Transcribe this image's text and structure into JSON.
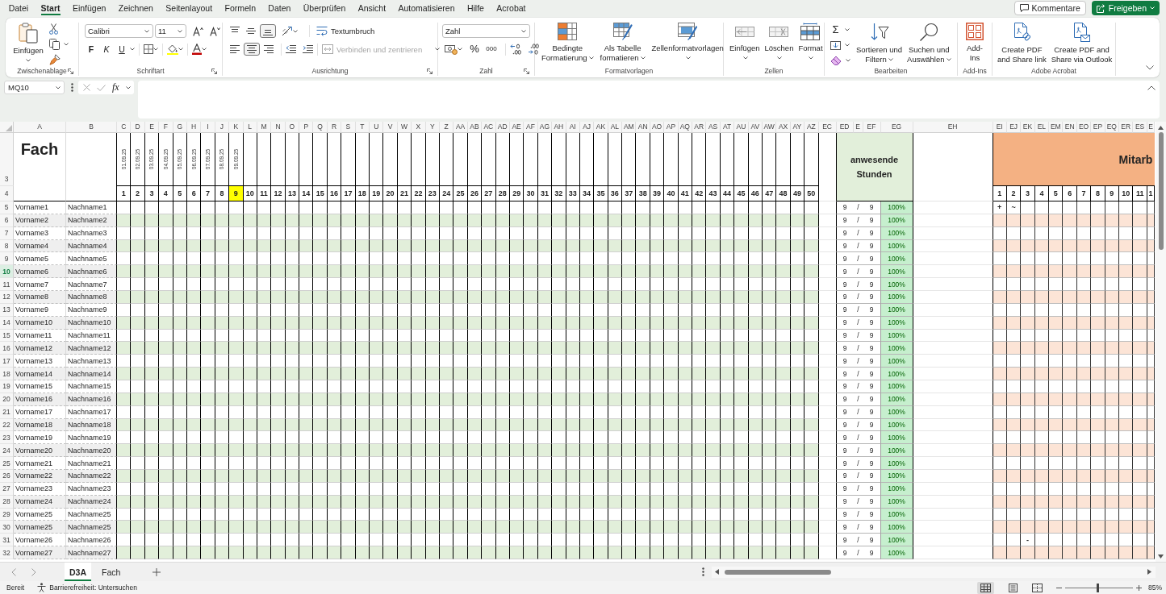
{
  "menu_tabs": [
    {
      "label": "Datei",
      "selected": false
    },
    {
      "label": "Start",
      "selected": true
    },
    {
      "label": "Einfügen",
      "selected": false
    },
    {
      "label": "Zeichnen",
      "selected": false
    },
    {
      "label": "Seitenlayout",
      "selected": false
    },
    {
      "label": "Formeln",
      "selected": false
    },
    {
      "label": "Daten",
      "selected": false
    },
    {
      "label": "Überprüfen",
      "selected": false
    },
    {
      "label": "Ansicht",
      "selected": false
    },
    {
      "label": "Automatisieren",
      "selected": false
    },
    {
      "label": "Hilfe",
      "selected": false
    },
    {
      "label": "Acrobat",
      "selected": false
    }
  ],
  "header_buttons": [
    {
      "label": "Kommentare",
      "kind": "outline"
    },
    {
      "label": "Freigeben",
      "kind": "primary"
    }
  ],
  "ribbon": {
    "clipboard": {
      "label": "Zwischenablage",
      "paste": {
        "lines": [
          "Einfügen"
        ],
        "menu": true
      }
    },
    "font": {
      "label": "Schriftart",
      "font_name": "Calibri",
      "font_size": "11",
      "bold": "F",
      "italic": "K",
      "underline": "U"
    },
    "alignment": {
      "label": "Ausrichtung",
      "vertical_align": [
        {
          "selected": false
        },
        {
          "selected": false
        },
        {
          "selected": true
        }
      ],
      "horizontal_align": [
        {
          "selected": false
        },
        {
          "selected": true
        },
        {
          "selected": false
        }
      ],
      "wrap_text": "Textumbruch",
      "merge": {
        "label": "Verbinden und zentrieren",
        "disabled": true
      }
    },
    "number": {
      "label": "Zahl",
      "format": "Zahl",
      "percent": "%",
      "thousands": "000"
    },
    "styles": {
      "label": "Formatvorlagen",
      "buttons": [
        {
          "lines": [
            "Bedingte",
            "Formatierung"
          ],
          "menu": true
        },
        {
          "lines": [
            "Als Tabelle",
            "formatieren"
          ],
          "menu": true
        },
        {
          "lines": [
            "Zellenformatvorlagen"
          ],
          "menu": true
        }
      ]
    },
    "cells": {
      "label": "Zellen",
      "buttons": [
        {
          "lines": [
            "Einfügen"
          ],
          "menu": true
        },
        {
          "lines": [
            "Löschen"
          ],
          "menu": true
        },
        {
          "lines": [
            "Format"
          ],
          "menu": true
        }
      ]
    },
    "editing": {
      "label": "Bearbeiten",
      "autosum": "Σ",
      "buttons": [
        {
          "lines": [
            "Sortieren und",
            "Filtern"
          ],
          "menu": true
        },
        {
          "lines": [
            "Suchen und",
            "Auswählen"
          ],
          "menu": true
        }
      ]
    },
    "addins": {
      "label": "Add-Ins",
      "button": {
        "lines": [
          "Add-",
          "Ins"
        ]
      }
    },
    "acrobat": {
      "label": "Adobe Acrobat",
      "buttons": [
        {
          "lines": [
            "Create PDF",
            "and Share link"
          ]
        },
        {
          "lines": [
            "Create PDF and",
            "Share via Outlook"
          ]
        }
      ]
    }
  },
  "formula_bar": {
    "name_box": "MQ10",
    "function_label": "fx"
  },
  "sheet": {
    "columns": [
      {
        "letter": "A",
        "kind": "first_name"
      },
      {
        "letter": "B",
        "kind": "last_name"
      },
      {
        "letter": "C",
        "kind": "day"
      },
      {
        "letter": "D",
        "kind": "day"
      },
      {
        "letter": "E",
        "kind": "day"
      },
      {
        "letter": "F",
        "kind": "day"
      },
      {
        "letter": "G",
        "kind": "day"
      },
      {
        "letter": "H",
        "kind": "day"
      },
      {
        "letter": "I",
        "kind": "day"
      },
      {
        "letter": "J",
        "kind": "day"
      },
      {
        "letter": "K",
        "kind": "day"
      },
      {
        "letter": "L",
        "kind": "day"
      },
      {
        "letter": "M",
        "kind": "day"
      },
      {
        "letter": "N",
        "kind": "day"
      },
      {
        "letter": "O",
        "kind": "day"
      },
      {
        "letter": "P",
        "kind": "day"
      },
      {
        "letter": "Q",
        "kind": "day"
      },
      {
        "letter": "R",
        "kind": "day"
      },
      {
        "letter": "S",
        "kind": "day"
      },
      {
        "letter": "T",
        "kind": "day"
      },
      {
        "letter": "U",
        "kind": "day"
      },
      {
        "letter": "V",
        "kind": "day"
      },
      {
        "letter": "W",
        "kind": "day"
      },
      {
        "letter": "X",
        "kind": "day"
      },
      {
        "letter": "Y",
        "kind": "day"
      },
      {
        "letter": "Z",
        "kind": "day"
      },
      {
        "letter": "AA",
        "kind": "day"
      },
      {
        "letter": "AB",
        "kind": "day"
      },
      {
        "letter": "AC",
        "kind": "day"
      },
      {
        "letter": "AD",
        "kind": "day"
      },
      {
        "letter": "AE",
        "kind": "day"
      },
      {
        "letter": "AF",
        "kind": "day"
      },
      {
        "letter": "AG",
        "kind": "day"
      },
      {
        "letter": "AH",
        "kind": "day"
      },
      {
        "letter": "AI",
        "kind": "day"
      },
      {
        "letter": "AJ",
        "kind": "day"
      },
      {
        "letter": "AK",
        "kind": "day"
      },
      {
        "letter": "AL",
        "kind": "day"
      },
      {
        "letter": "AM",
        "kind": "day"
      },
      {
        "letter": "AN",
        "kind": "day"
      },
      {
        "letter": "AO",
        "kind": "day"
      },
      {
        "letter": "AP",
        "kind": "day"
      },
      {
        "letter": "AQ",
        "kind": "day"
      },
      {
        "letter": "AR",
        "kind": "day"
      },
      {
        "letter": "AS",
        "kind": "day"
      },
      {
        "letter": "AT",
        "kind": "day"
      },
      {
        "letter": "AU",
        "kind": "day"
      },
      {
        "letter": "AV",
        "kind": "day"
      },
      {
        "letter": "AW",
        "kind": "day"
      },
      {
        "letter": "AX",
        "kind": "day"
      },
      {
        "letter": "AY",
        "kind": "day"
      },
      {
        "letter": "AZ",
        "kind": "day"
      },
      {
        "letter": "EC",
        "kind": "gap"
      },
      {
        "letter": "ED",
        "kind": "hours"
      },
      {
        "letter": "E",
        "kind": "slash"
      },
      {
        "letter": "EF",
        "kind": "total"
      },
      {
        "letter": "EG",
        "kind": "percent"
      },
      {
        "letter": "EH",
        "kind": "spacer"
      },
      {
        "letter": "EI",
        "kind": "staff"
      },
      {
        "letter": "EJ",
        "kind": "staff"
      },
      {
        "letter": "EK",
        "kind": "staff"
      },
      {
        "letter": "EL",
        "kind": "staff"
      },
      {
        "letter": "EM",
        "kind": "staff"
      },
      {
        "letter": "EN",
        "kind": "staff"
      },
      {
        "letter": "EO",
        "kind": "staff"
      },
      {
        "letter": "EP",
        "kind": "staff"
      },
      {
        "letter": "EQ",
        "kind": "staff"
      },
      {
        "letter": "ER",
        "kind": "staff"
      },
      {
        "letter": "ES",
        "kind": "staff"
      },
      {
        "letter": "E",
        "kind": "staff"
      }
    ],
    "header_rows": [
      "3",
      "4"
    ],
    "title": "Fach",
    "dates": [
      "01.09.25",
      "02.09.25",
      "03.09.25",
      "04.09.25",
      "05.09.25",
      "06.09.25",
      "07.09.25",
      "08.09.25",
      "09.09.25"
    ],
    "day_numbers": [
      {
        "label": "1",
        "highlighted": false
      },
      {
        "label": "2",
        "highlighted": false
      },
      {
        "label": "3",
        "highlighted": false
      },
      {
        "label": "4",
        "highlighted": false
      },
      {
        "label": "5",
        "highlighted": false
      },
      {
        "label": "6",
        "highlighted": false
      },
      {
        "label": "7",
        "highlighted": false
      },
      {
        "label": "8",
        "highlighted": false
      },
      {
        "label": "9",
        "highlighted": true
      },
      {
        "label": "10",
        "highlighted": false
      },
      {
        "label": "11",
        "highlighted": false
      },
      {
        "label": "12",
        "highlighted": false
      },
      {
        "label": "13",
        "highlighted": false
      },
      {
        "label": "14",
        "highlighted": false
      },
      {
        "label": "15",
        "highlighted": false
      },
      {
        "label": "16",
        "highlighted": false
      },
      {
        "label": "17",
        "highlighted": false
      },
      {
        "label": "18",
        "highlighted": false
      },
      {
        "label": "19",
        "highlighted": false
      },
      {
        "label": "20",
        "highlighted": false
      },
      {
        "label": "21",
        "highlighted": false
      },
      {
        "label": "22",
        "highlighted": false
      },
      {
        "label": "23",
        "highlighted": false
      },
      {
        "label": "24",
        "highlighted": false
      },
      {
        "label": "25",
        "highlighted": false
      },
      {
        "label": "26",
        "highlighted": false
      },
      {
        "label": "27",
        "highlighted": false
      },
      {
        "label": "28",
        "highlighted": false
      },
      {
        "label": "29",
        "highlighted": false
      },
      {
        "label": "30",
        "highlighted": false
      },
      {
        "label": "31",
        "highlighted": false
      },
      {
        "label": "32",
        "highlighted": false
      },
      {
        "label": "33",
        "highlighted": false
      },
      {
        "label": "34",
        "highlighted": false
      },
      {
        "label": "35",
        "highlighted": false
      },
      {
        "label": "36",
        "highlighted": false
      },
      {
        "label": "37",
        "highlighted": false
      },
      {
        "label": "38",
        "highlighted": false
      },
      {
        "label": "39",
        "highlighted": false
      },
      {
        "label": "40",
        "highlighted": false
      },
      {
        "label": "41",
        "highlighted": false
      },
      {
        "label": "42",
        "highlighted": false
      },
      {
        "label": "43",
        "highlighted": false
      },
      {
        "label": "44",
        "highlighted": false
      },
      {
        "label": "45",
        "highlighted": false
      },
      {
        "label": "46",
        "highlighted": false
      },
      {
        "label": "47",
        "highlighted": false
      },
      {
        "label": "48",
        "highlighted": false
      },
      {
        "label": "49",
        "highlighted": false
      },
      {
        "label": "50",
        "highlighted": false
      }
    ],
    "attendance_header": "anwesende Stunden",
    "staff_header": "Mitarb",
    "staff_numbers": [
      "1",
      "2",
      "3",
      "4",
      "5",
      "6",
      "7",
      "8",
      "9",
      "10",
      "11",
      "1"
    ],
    "rows": [
      {
        "number": "5",
        "selected": false,
        "first_name": "Vorname1",
        "last_name": "Nachname1",
        "hours": "9",
        "slash": "/",
        "total": "9",
        "percent": "100%",
        "staff_cells": [
          {
            "kind": "mark",
            "text": "+"
          },
          {
            "kind": "mark",
            "text": "~"
          }
        ]
      },
      {
        "number": "6",
        "selected": false,
        "first_name": "Vorname2",
        "last_name": "Nachname2",
        "hours": "9",
        "slash": "/",
        "total": "9",
        "percent": "100%"
      },
      {
        "number": "7",
        "selected": false,
        "first_name": "Vorname3",
        "last_name": "Nachname3",
        "hours": "9",
        "slash": "/",
        "total": "9",
        "percent": "100%"
      },
      {
        "number": "8",
        "selected": false,
        "first_name": "Vorname4",
        "last_name": "Nachname4",
        "hours": "9",
        "slash": "/",
        "total": "9",
        "percent": "100%"
      },
      {
        "number": "9",
        "selected": false,
        "first_name": "Vorname5",
        "last_name": "Nachname5",
        "hours": "9",
        "slash": "/",
        "total": "9",
        "percent": "100%"
      },
      {
        "number": "10",
        "selected": true,
        "first_name": "Vorname6",
        "last_name": "Nachname6",
        "hours": "9",
        "slash": "/",
        "total": "9",
        "percent": "100%"
      },
      {
        "number": "11",
        "selected": false,
        "first_name": "Vorname7",
        "last_name": "Nachname7",
        "hours": "9",
        "slash": "/",
        "total": "9",
        "percent": "100%"
      },
      {
        "number": "12",
        "selected": false,
        "first_name": "Vorname8",
        "last_name": "Nachname8",
        "hours": "9",
        "slash": "/",
        "total": "9",
        "percent": "100%"
      },
      {
        "number": "13",
        "selected": false,
        "first_name": "Vorname9",
        "last_name": "Nachname9",
        "hours": "9",
        "slash": "/",
        "total": "9",
        "percent": "100%"
      },
      {
        "number": "14",
        "selected": false,
        "first_name": "Vorname10",
        "last_name": "Nachname10",
        "hours": "9",
        "slash": "/",
        "total": "9",
        "percent": "100%"
      },
      {
        "number": "15",
        "selected": false,
        "first_name": "Vorname11",
        "last_name": "Nachname11",
        "hours": "9",
        "slash": "/",
        "total": "9",
        "percent": "100%"
      },
      {
        "number": "16",
        "selected": false,
        "first_name": "Vorname12",
        "last_name": "Nachname12",
        "hours": "9",
        "slash": "/",
        "total": "9",
        "percent": "100%"
      },
      {
        "number": "17",
        "selected": false,
        "first_name": "Vorname13",
        "last_name": "Nachname13",
        "hours": "9",
        "slash": "/",
        "total": "9",
        "percent": "100%"
      },
      {
        "number": "18",
        "selected": false,
        "first_name": "Vorname14",
        "last_name": "Nachname14",
        "hours": "9",
        "slash": "/",
        "total": "9",
        "percent": "100%"
      },
      {
        "number": "19",
        "selected": false,
        "first_name": "Vorname15",
        "last_name": "Nachname15",
        "hours": "9",
        "slash": "/",
        "total": "9",
        "percent": "100%"
      },
      {
        "number": "20",
        "selected": false,
        "first_name": "Vorname16",
        "last_name": "Nachname16",
        "hours": "9",
        "slash": "/",
        "total": "9",
        "percent": "100%"
      },
      {
        "number": "21",
        "selected": false,
        "first_name": "Vorname17",
        "last_name": "Nachname17",
        "hours": "9",
        "slash": "/",
        "total": "9",
        "percent": "100%"
      },
      {
        "number": "22",
        "selected": false,
        "first_name": "Vorname18",
        "last_name": "Nachname18",
        "hours": "9",
        "slash": "/",
        "total": "9",
        "percent": "100%"
      },
      {
        "number": "23",
        "selected": false,
        "first_name": "Vorname19",
        "last_name": "Nachname19",
        "hours": "9",
        "slash": "/",
        "total": "9",
        "percent": "100%"
      },
      {
        "number": "24",
        "selected": false,
        "first_name": "Vorname20",
        "last_name": "Nachname20",
        "hours": "9",
        "slash": "/",
        "total": "9",
        "percent": "100%"
      },
      {
        "number": "25",
        "selected": false,
        "first_name": "Vorname21",
        "last_name": "Nachname21",
        "hours": "9",
        "slash": "/",
        "total": "9",
        "percent": "100%"
      },
      {
        "number": "26",
        "selected": false,
        "first_name": "Vorname22",
        "last_name": "Nachname22",
        "hours": "9",
        "slash": "/",
        "total": "9",
        "percent": "100%"
      },
      {
        "number": "27",
        "selected": false,
        "first_name": "Vorname23",
        "last_name": "Nachname23",
        "hours": "9",
        "slash": "/",
        "total": "9",
        "percent": "100%"
      },
      {
        "number": "28",
        "selected": false,
        "first_name": "Vorname24",
        "last_name": "Nachname24",
        "hours": "9",
        "slash": "/",
        "total": "9",
        "percent": "100%"
      },
      {
        "number": "29",
        "selected": false,
        "first_name": "Vorname25",
        "last_name": "Nachname25",
        "hours": "9",
        "slash": "/",
        "total": "9",
        "percent": "100%"
      },
      {
        "number": "30",
        "selected": false,
        "first_name": "Vorname25",
        "last_name": "Nachname25",
        "hours": "9",
        "slash": "/",
        "total": "9",
        "percent": "100%"
      },
      {
        "number": "31",
        "selected": false,
        "first_name": "Vorname26",
        "last_name": "Nachname26",
        "hours": "9",
        "slash": "/",
        "total": "9",
        "percent": "100%",
        "staff_cells": [
          {
            "kind": "empty"
          },
          {
            "kind": "empty"
          },
          {
            "kind": "mark",
            "text": "-"
          }
        ]
      },
      {
        "number": "32",
        "selected": false,
        "first_name": "Vorname27",
        "last_name": "Nachname27",
        "hours": "9",
        "slash": "/",
        "total": "9",
        "percent": "100%"
      }
    ]
  },
  "sheet_tabs": [
    {
      "label": "D3A",
      "selected": true
    },
    {
      "label": "Fach",
      "selected": false
    }
  ],
  "status_bar": {
    "status": "Bereit",
    "accessibility": "Barrierefreiheit: Untersuchen",
    "views": [
      {
        "selected": true
      },
      {
        "selected": false
      },
      {
        "selected": false
      }
    ],
    "zoom": {
      "level": 0.48,
      "reading": "85%"
    }
  }
}
